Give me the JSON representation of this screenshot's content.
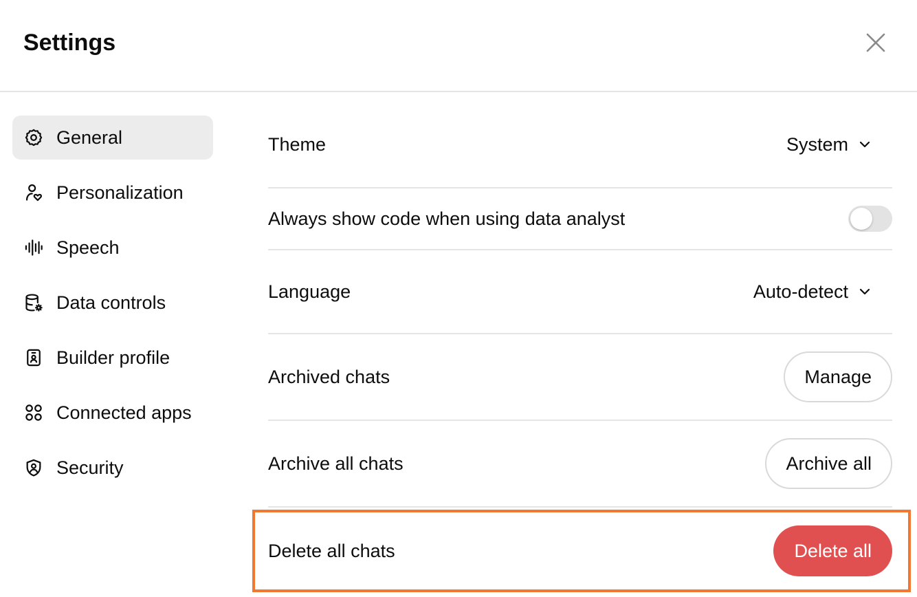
{
  "header": {
    "title": "Settings",
    "close_icon": "close-icon"
  },
  "sidebar": {
    "items": [
      {
        "label": "General",
        "icon": "gear-icon",
        "active": true
      },
      {
        "label": "Personalization",
        "icon": "person-heart-icon",
        "active": false
      },
      {
        "label": "Speech",
        "icon": "waveform-icon",
        "active": false
      },
      {
        "label": "Data controls",
        "icon": "database-gear-icon",
        "active": false
      },
      {
        "label": "Builder profile",
        "icon": "badge-icon",
        "active": false
      },
      {
        "label": "Connected apps",
        "icon": "apps-grid-icon",
        "active": false
      },
      {
        "label": "Security",
        "icon": "shield-icon",
        "active": false
      }
    ]
  },
  "general": {
    "theme": {
      "label": "Theme",
      "value": "System"
    },
    "show_code": {
      "label": "Always show code when using data analyst",
      "enabled": false
    },
    "language": {
      "label": "Language",
      "value": "Auto-detect"
    },
    "archived_chats": {
      "label": "Archived chats",
      "button": "Manage"
    },
    "archive_all": {
      "label": "Archive all chats",
      "button": "Archive all"
    },
    "delete_all": {
      "label": "Delete all chats",
      "button": "Delete all"
    }
  },
  "colors": {
    "danger": "#e05050",
    "highlight": "#f07830",
    "active_nav": "#ececec"
  }
}
